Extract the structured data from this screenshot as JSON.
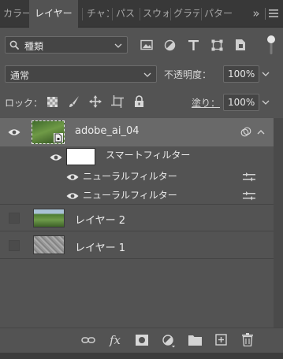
{
  "tabs": [
    {
      "label": "カラー",
      "active": false
    },
    {
      "label": "レイヤー",
      "active": true
    },
    {
      "label": "チャンネル",
      "active": false
    },
    {
      "label": "パス",
      "active": false
    },
    {
      "label": "スウォッチ",
      "active": false
    },
    {
      "label": "グラデーション",
      "active": false
    },
    {
      "label": "パターン",
      "active": false
    }
  ],
  "tab_overflow": "»",
  "filter": {
    "kind_label": "種類"
  },
  "blend_mode": "通常",
  "opacity": {
    "label": "不透明度：",
    "value": "100%"
  },
  "lock": {
    "label": "ロック："
  },
  "fill": {
    "label": "塗り：",
    "value": "100%"
  },
  "layers": {
    "smart": {
      "name": "adobe_ai_04"
    },
    "smart_filter_label": "スマートフィルター",
    "filters": [
      {
        "name": "ニューラルフィルター"
      },
      {
        "name": "ニューラルフィルター"
      }
    ],
    "layer2": {
      "name": "レイヤー 2"
    },
    "layer1": {
      "name": "レイヤー 1"
    }
  },
  "footer": {
    "fx_label": "fx"
  },
  "colors": {
    "panel": "#535353",
    "tabbar": "#383838",
    "selected": "#696969"
  }
}
